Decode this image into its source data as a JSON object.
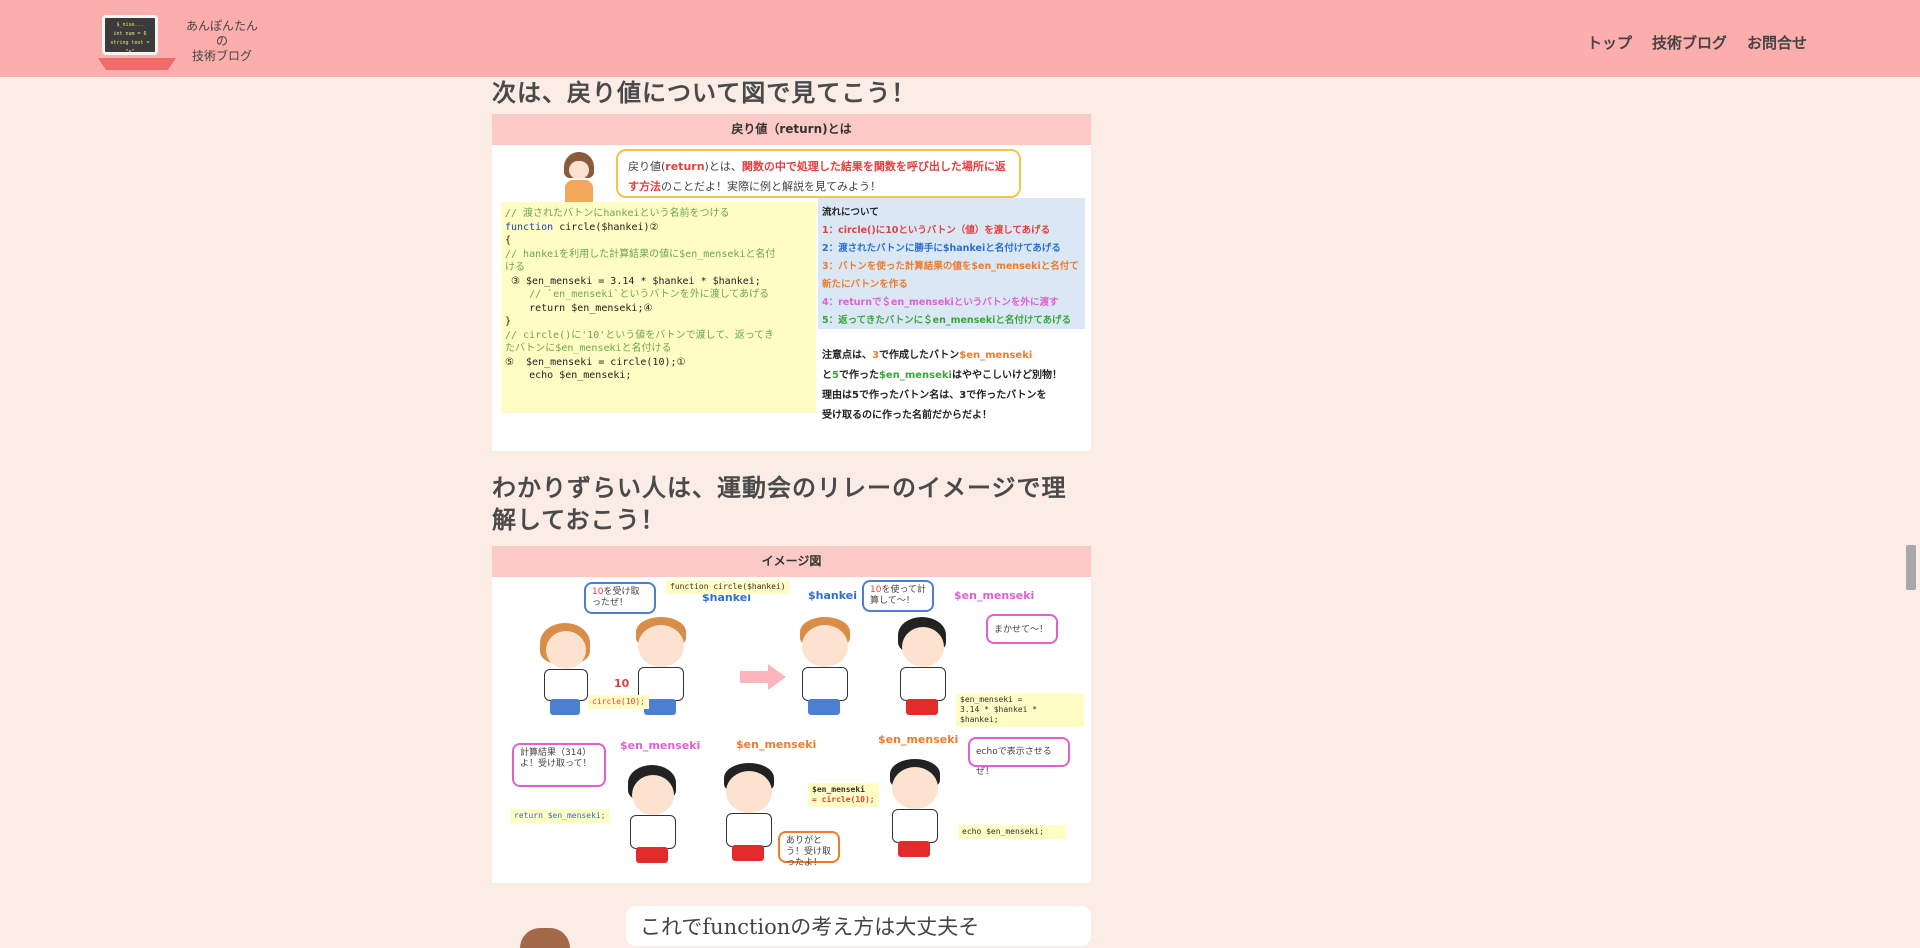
{
  "header": {
    "logo_screen_lines": [
      "$_nise...",
      "int num = 6",
      "string text = \"e\""
    ],
    "site_name_lines": [
      "あんぽんたん",
      "の",
      "技術ブログ"
    ],
    "nav": [
      "トップ",
      "技術ブログ",
      "お問合せ"
    ]
  },
  "section1": {
    "heading": "次は、戻り値について図で見てこう！",
    "card_title": "戻り値（return)とは",
    "bubble_pre": "戻り値(",
    "bubble_return": "return",
    "bubble_mid": ")とは、",
    "bubble_red": "関数の中で処理した結果を関数を呼び出した場所に返す方法",
    "bubble_post": "のことだよ！実際に例と解説を見てみよう！",
    "code": {
      "l1": "// 渡されたバトンにhankeiという名前をつける",
      "l2_kw": "function",
      "l2_rest": " circle($hankei)②",
      "l3": "{",
      "l4": "// hankeiを利用した計算結果の値に$en_mensekiと名付",
      "l5": "ける",
      "l6": " ③ $en_menseki = 3.14 * $hankei * $hankei;",
      "l7": "",
      "l8": "    // `en_menseki`というバトンを外に渡してあげる",
      "l9": "    return $en_menseki;④",
      "l10": "}",
      "l11": "",
      "l12": "// circle()に'10'という値をバトンで渡して、返ってき",
      "l13": "たバトンに$en_mensekiと名付ける",
      "l14": "⑤  $en_menseki = circle(10);①",
      "l15": "    echo $en_menseki;"
    },
    "flow": {
      "title": "流れについて",
      "steps": [
        {
          "text": "1：circle()に10というバトン（値）を渡してあげる",
          "color": "#e43e3e"
        },
        {
          "text": "2：渡されたバトンに勝手に$hankeiと名付けてあげる",
          "color": "#2d6fd0"
        },
        {
          "text": "3：バトンを使った計算結果の値を$en_mensekiと名付て",
          "color": "#f07b2a"
        },
        {
          "text": "新たにバトンを作る",
          "color": "#f07b2a"
        },
        {
          "text": "4：returnで＄en_mensekiというバトンを外に渡す",
          "color": "#e060d0"
        },
        {
          "text": "5：返ってきたバトンに＄en_mensekiと名付けてあげる",
          "color": "#3aa63a"
        }
      ]
    },
    "note": {
      "p1": "注意点は、",
      "n3": "3",
      "p2": "で作成したバトン",
      "v1": "$en_menseki",
      "p3": "と",
      "n5": "5",
      "p4": "で作った",
      "v2": "$en_menseki",
      "p5": "はややこしいけど別物！",
      "p6": "理由は5で作ったバトン名は、3で作ったバトンを",
      "p7": "受け取るのに作った名前だからだよ！"
    }
  },
  "section2": {
    "heading": "わかりずらい人は、運動会のリレーのイメージで理解しておこう！",
    "card_title": "イメージ図",
    "labels": {
      "hankei1": "$hankei",
      "hankei2": "$hankei",
      "en1": "$en_menseki",
      "en2": "$en_menseki",
      "en3": "$en_menseki",
      "en4": "$en_menseki",
      "ten": "10"
    },
    "bubbles": {
      "b1_red": "10",
      "b1": "を受け取ったぜ！",
      "b2_red": "10",
      "b2": "を使って計算して〜！",
      "b3": "まかせて〜！",
      "b4": "計算結果（314）よ！受け取って！",
      "b5": "ありがとう！受け取ったよ！",
      "b6": "echoで表示させるぜ！"
    },
    "codes": {
      "func": "function circle($hankei)",
      "circle": "circle(10);",
      "calc1": "$en_menseki =",
      "calc2": "3.14 * $hankei * $hankei;",
      "ret": "return $en_menseki;",
      "assign1": "$en_menseki",
      "assign2": "= circle(10);",
      "echo": "echo $en_menseki;"
    }
  },
  "bottom_bubble": "これでfunctionの考え方は大丈夫そ",
  "colors": {
    "header_bg": "#fbaeac",
    "page_bg": "#fbece6",
    "card_title_bg": "#fbc9c6",
    "code_bg": "#fffcc4",
    "flow_bg": "#dae7f5"
  }
}
